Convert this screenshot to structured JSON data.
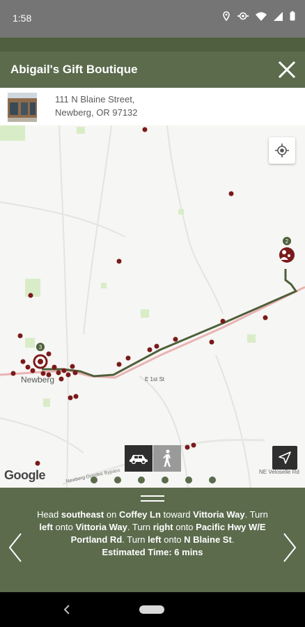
{
  "status_bar": {
    "time": "1:58",
    "icons": [
      "location-icon",
      "eye-icon",
      "wifi-icon",
      "cellular-icon",
      "battery-icon"
    ]
  },
  "header": {
    "title": "Abigail's Gift Boutique",
    "close_icon": "close-icon"
  },
  "location": {
    "address_line1": "111 N Blaine Street,",
    "address_line2": "Newberg, OR 97132"
  },
  "map": {
    "labels": {
      "city": "Newberg",
      "street1": "E 1st St",
      "street2": "NE Veloselle Rd",
      "bypass": "Newberg Dundee Bypass",
      "google": "Google"
    },
    "markers": {
      "start_number": "3",
      "end_number": "2"
    },
    "colors": {
      "route": "#4f5f3a",
      "marker": "#7a1a1a",
      "highway": "#e8a0a0",
      "accent": "#5b6b4c"
    },
    "travel_modes": [
      {
        "name": "car",
        "selected": true
      },
      {
        "name": "walk",
        "selected": false
      }
    ]
  },
  "pager": {
    "total": 6
  },
  "directions": {
    "parts": [
      {
        "text": "Head ",
        "bold": false
      },
      {
        "text": "southeast",
        "bold": true
      },
      {
        "text": " on ",
        "bold": false
      },
      {
        "text": "Coffey Ln",
        "bold": true
      },
      {
        "text": " toward ",
        "bold": false
      },
      {
        "text": "Vittoria Way",
        "bold": true
      },
      {
        "text": ". Turn ",
        "bold": false
      },
      {
        "text": "left",
        "bold": true
      },
      {
        "text": " onto ",
        "bold": false
      },
      {
        "text": "Vittoria Way",
        "bold": true
      },
      {
        "text": ". Turn ",
        "bold": false
      },
      {
        "text": "right",
        "bold": true
      },
      {
        "text": " onto ",
        "bold": false
      },
      {
        "text": "Pacific Hwy W/E Portland Rd",
        "bold": true
      },
      {
        "text": ". Turn ",
        "bold": false
      },
      {
        "text": "left",
        "bold": true
      },
      {
        "text": " onto ",
        "bold": false
      },
      {
        "text": "N Blaine St",
        "bold": true
      },
      {
        "text": ".",
        "bold": false
      }
    ],
    "estimated_time": "Estimated Time: 6 mins"
  }
}
